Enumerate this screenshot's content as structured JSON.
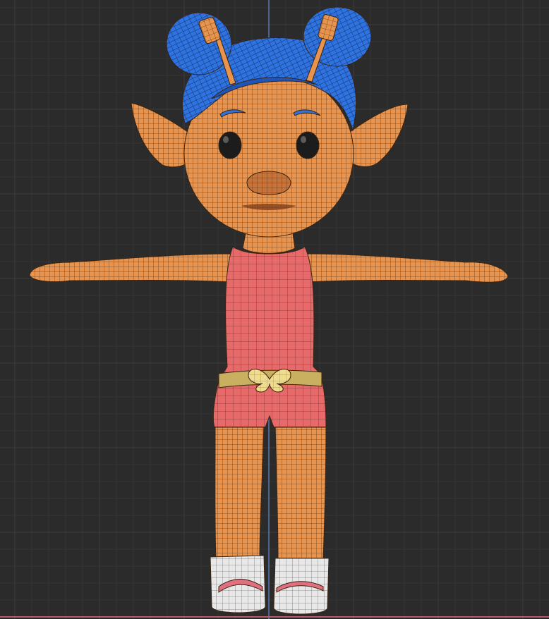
{
  "viewport": {
    "background": "#2b2b2b",
    "grid_minor_color": "#343434",
    "grid_major_color": "#3e3e3e",
    "axis_z_color": "#5a7fb8",
    "axis_x_color": "#b85a6a"
  },
  "model": {
    "skin_color": "#e8944e",
    "skin_shadow_color": "#c7733a",
    "hair_color": "#2f73e0",
    "hair_shadow_color": "#1f55b8",
    "outfit_color": "#e66a6a",
    "belt_color": "#c9b060",
    "butterfly_color": "#f0dc8c",
    "shoe_color": "#e8e8e8",
    "shoe_trim_color": "#e07080",
    "wire_color": "#3a2410",
    "eye_color": "#1c1c1c",
    "antenna_color": "#e8944e"
  }
}
